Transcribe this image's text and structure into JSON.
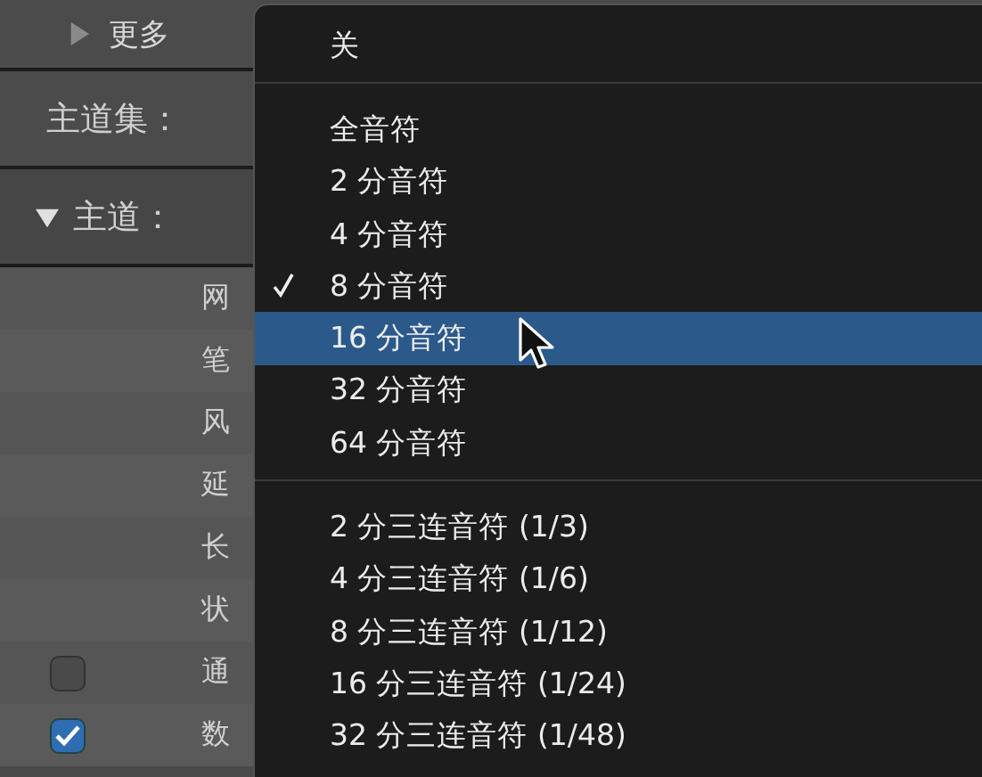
{
  "panel": {
    "more": {
      "label": "更多",
      "expanded": false
    },
    "set_label": "主道集：",
    "track": {
      "label": "主道：",
      "expanded": true
    },
    "rows": [
      {
        "label": "网",
        "kind": "plain"
      },
      {
        "label": "笔",
        "kind": "plain"
      },
      {
        "label": "风",
        "kind": "plain"
      },
      {
        "label": "延",
        "kind": "plain"
      },
      {
        "label": "长",
        "kind": "plain"
      },
      {
        "label": "状",
        "kind": "plain"
      },
      {
        "label": "通",
        "kind": "checkbox",
        "checked": false
      },
      {
        "label": "数",
        "kind": "checkbox",
        "checked": true
      }
    ]
  },
  "menu": {
    "sections": [
      [
        {
          "label": "关",
          "checked": false,
          "selected": false
        }
      ],
      [
        {
          "label": "全音符",
          "checked": false,
          "selected": false
        },
        {
          "label": "2 分音符",
          "checked": false,
          "selected": false
        },
        {
          "label": "4 分音符",
          "checked": false,
          "selected": false
        },
        {
          "label": "8 分音符",
          "checked": true,
          "selected": false
        },
        {
          "label": "16 分音符",
          "checked": false,
          "selected": true
        },
        {
          "label": "32 分音符",
          "checked": false,
          "selected": false
        },
        {
          "label": "64 分音符",
          "checked": false,
          "selected": false
        }
      ],
      [
        {
          "label": "2 分三连音符 (1/3)",
          "checked": false,
          "selected": false
        },
        {
          "label": "4 分三连音符 (1/6)",
          "checked": false,
          "selected": false
        },
        {
          "label": "8 分三连音符 (1/12)",
          "checked": false,
          "selected": false
        },
        {
          "label": "16 分三连音符 (1/24)",
          "checked": false,
          "selected": false
        },
        {
          "label": "32 分三连音符 (1/48)",
          "checked": false,
          "selected": false
        }
      ]
    ]
  }
}
